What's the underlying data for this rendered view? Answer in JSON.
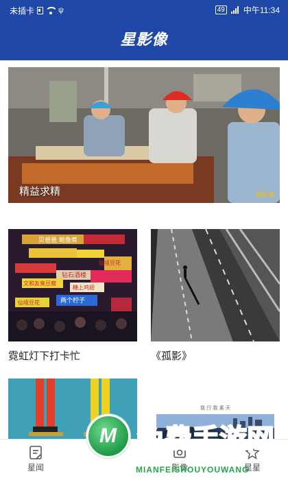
{
  "status_bar": {
    "carrier": "未插卡",
    "battery": "49",
    "time": "中午11:34"
  },
  "header": {
    "title": "星影像"
  },
  "hero": {
    "caption": "精益求精",
    "watermark": "星影像"
  },
  "cards": [
    {
      "title": "霓虹灯下打卡忙",
      "sign_texts": [
        "贝爸爸 鲍鱼煮",
        "钻石酒楼",
        "仙境豆花",
        "文和友臭豆腐",
        "糖上鸡翅",
        "两个柠子",
        "仙境豆花"
      ]
    },
    {
      "title": "《孤影》"
    },
    {
      "title": ""
    },
    {
      "title": "",
      "heading_text": "我 行 我 素 天"
    }
  ],
  "bottom_nav": [
    {
      "label": "星闻",
      "icon": "news-icon"
    },
    {
      "label": "影像",
      "icon": "image-icon"
    },
    {
      "label": "星星",
      "icon": "star-icon"
    }
  ],
  "overlay_promo": {
    "text": "免费手游网",
    "subtext": "MIANFEISHOUYOUWANG"
  },
  "colors": {
    "header_bg": "#1e47a8",
    "promo_green": "#20a845"
  }
}
